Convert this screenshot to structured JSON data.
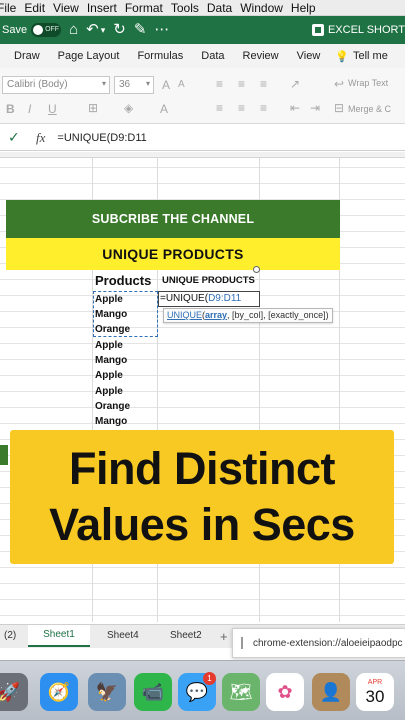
{
  "menubar": {
    "items": [
      "File",
      "Edit",
      "View",
      "Insert",
      "Format",
      "Tools",
      "Data",
      "Window",
      "Help"
    ]
  },
  "toolbar": {
    "autosave_label": "Save",
    "autosave_state": "OFF",
    "document_title": "EXCEL SHORT"
  },
  "ribbon_tabs": [
    "Draw",
    "Page Layout",
    "Formulas",
    "Data",
    "Review",
    "View"
  ],
  "tell_me": "Tell me",
  "ribbon": {
    "font_name": "Calibri (Body)",
    "font_size": "36",
    "wrap_text": "Wrap Text",
    "merge": "Merge & C"
  },
  "formula_bar": {
    "fx": "fx",
    "formula": "=UNIQUE(D9:D11"
  },
  "sheet": {
    "banner_green": "SUBCRIBE THE CHANNEL",
    "banner_yellow": "UNIQUE PRODUCTS",
    "col_products_header": "Products",
    "col_unique_header": "UNIQUE PRODUCTS",
    "products": [
      "Apple",
      "Mango",
      "Orange",
      "Apple",
      "Mango",
      "Apple",
      "Apple",
      "Orange",
      "Mango"
    ],
    "edit_prefix": "=UNIQUE(",
    "edit_ref": "D9:D11",
    "tooltip_fn": "UNIQUE",
    "tooltip_open": "(",
    "tooltip_arg1": "array",
    "tooltip_rest": ", [by_col], [exactly_once])"
  },
  "caption": {
    "line1": "Find Distinct",
    "line2": "Values in Secs"
  },
  "sheet_tabs": {
    "left_fragment": "(2)",
    "tabs": [
      "Sheet1",
      "Sheet4",
      "Sheet2"
    ],
    "active": "Sheet1",
    "plus": "+"
  },
  "extension_popup": "chrome-extension://aloeieipaodpc",
  "dock": {
    "facetime_badge": "1",
    "calendar_month": "APR",
    "calendar_day": "30"
  },
  "colors": {
    "excel_green": "#1f7244",
    "banner_green": "#3b7a2b",
    "banner_yellow": "#ffee2b",
    "caption_yellow": "#f9c923",
    "selection_blue": "#2f6fb6"
  }
}
